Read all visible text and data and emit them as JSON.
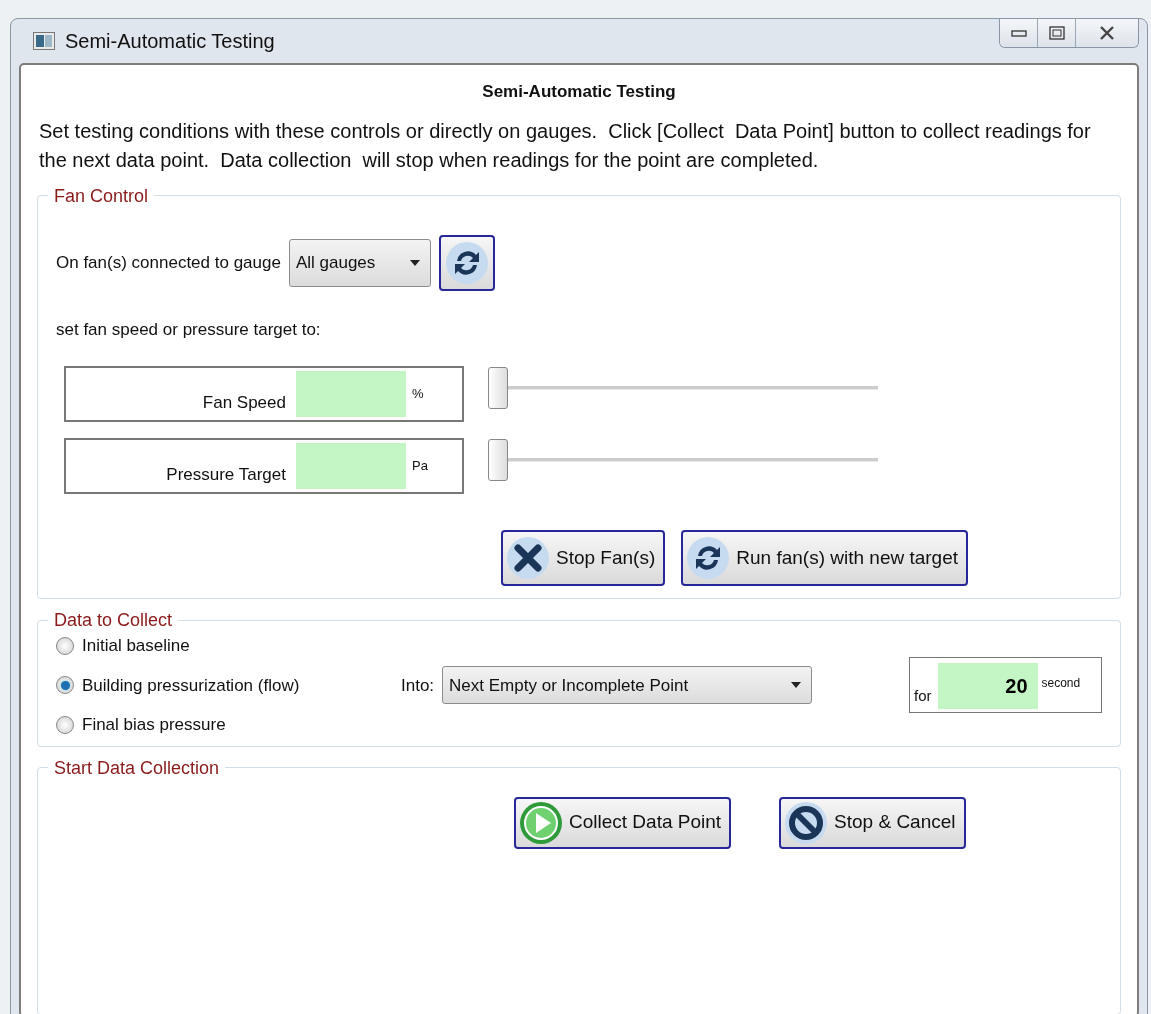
{
  "window": {
    "title": "Semi-Automatic Testing"
  },
  "heading": "Semi-Automatic Testing",
  "instructions": "Set testing conditions with these controls or directly on gauges.  Click [Collect  Data Point] button to collect readings for the next data point.  Data collection  will stop when readings for the point are completed.",
  "fan_control": {
    "legend": "Fan Control",
    "gauge_label": "On fan(s) connected to gauge",
    "gauge_select": "All gauges",
    "target_label": "set fan speed or pressure target to:",
    "targets": [
      {
        "label": "Fan Speed",
        "unit": "%",
        "level": 0
      },
      {
        "label": "Pressure Target",
        "unit": "Pa",
        "level": 0
      }
    ],
    "buttons": [
      {
        "kind": "stop",
        "label": "Stop Fan(s)"
      },
      {
        "kind": "refresh",
        "label": "Run fan(s) with new target"
      }
    ]
  },
  "data_to_collect": {
    "legend": "Data to Collect",
    "options": [
      {
        "label": "Initial baseline",
        "selected": false
      },
      {
        "label": "Building pressurization (flow)",
        "selected": true
      },
      {
        "label": "Final bias pressure",
        "selected": false
      }
    ],
    "into_label": "Into:",
    "into_select": "Next Empty or Incomplete Point",
    "duration": {
      "prefix": "for",
      "value": "20",
      "unit": "second"
    }
  },
  "start": {
    "legend": "Start Data Collection",
    "buttons": [
      {
        "kind": "play",
        "label": "Collect Data Point"
      },
      {
        "kind": "cancel",
        "label": "Stop & Cancel"
      }
    ]
  }
}
